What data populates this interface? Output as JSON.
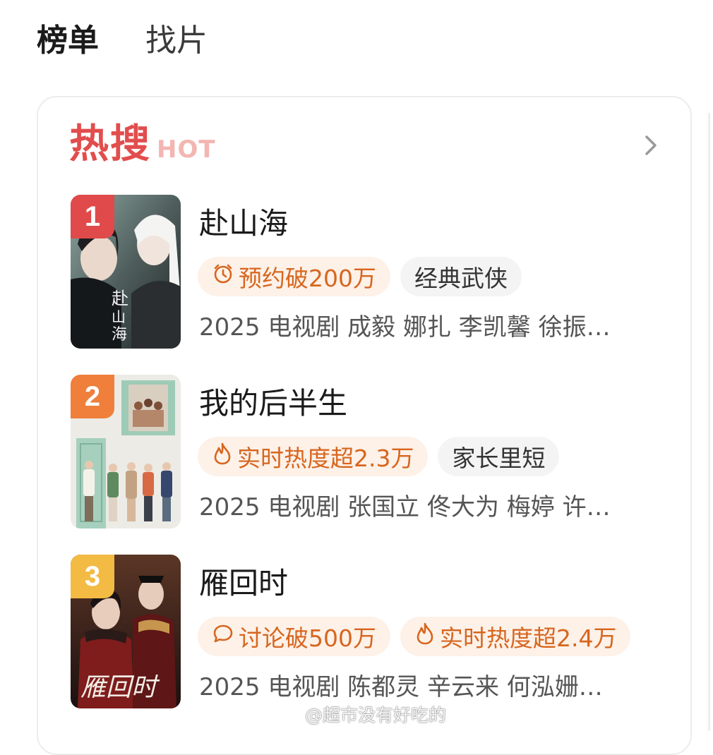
{
  "tabs": [
    {
      "label": "榜单",
      "active": true
    },
    {
      "label": "找片",
      "active": false
    }
  ],
  "section": {
    "title": "热搜",
    "title_sub": "HOT",
    "arrow_icon": "chevron-right-icon"
  },
  "items": [
    {
      "rank": "1",
      "rank_color": "#e04a4a",
      "title": "赴山海",
      "tags": [
        {
          "icon": "alarm-clock-icon",
          "text": "预约破200万",
          "style": "hot"
        },
        {
          "text": "经典武侠",
          "style": "plain"
        }
      ],
      "meta": "2025 电视剧 成毅 娜扎 李凯馨 徐振…"
    },
    {
      "rank": "2",
      "rank_color": "#ef7f3a",
      "title": "我的后半生",
      "tags": [
        {
          "icon": "flame-icon",
          "text": "实时热度超2.3万",
          "style": "hot"
        },
        {
          "text": "家长里短",
          "style": "plain"
        }
      ],
      "meta": "2025 电视剧 张国立 佟大为 梅婷 许…"
    },
    {
      "rank": "3",
      "rank_color": "#f3bb44",
      "title": "雁回时",
      "tags": [
        {
          "icon": "chat-bubble-icon",
          "text": "讨论破500万",
          "style": "hot"
        },
        {
          "icon": "flame-icon",
          "text": "实时热度超2.4万",
          "style": "hot"
        }
      ],
      "meta": "2025 电视剧 陈都灵 辛云来 何泓姗…"
    }
  ],
  "watermark": {
    "icon": "weibo-logo-icon",
    "text": "@超市没有好吃的"
  },
  "colors": {
    "accent_red": "#e24d4d",
    "tag_orange": "#d7661f",
    "tag_orange_bg": "#fdf1e8"
  }
}
